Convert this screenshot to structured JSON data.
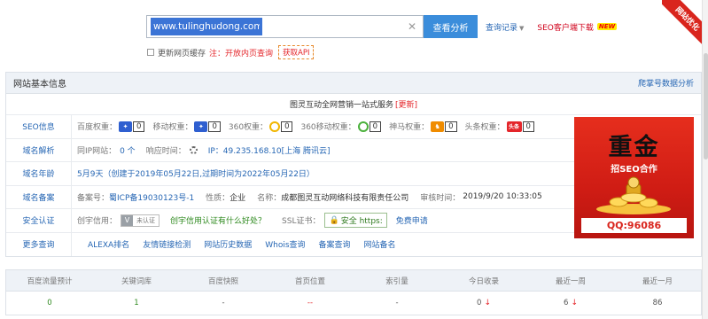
{
  "search": {
    "url_value": "www.tulinghudong.com/",
    "button_label": "查看分析",
    "history_label": "查询记录",
    "seo_download_label": "SEO客户端下载",
    "new_badge": "NEW"
  },
  "cache": {
    "label": "更新网页缓存",
    "note": "注：开放内页查询",
    "api_button": "获取API"
  },
  "ribbon_label": "网站优化",
  "panel": {
    "title": "网站基本信息",
    "right_link": "爬掌号数据分析",
    "company": "图灵互动全网营销一站式服务",
    "update": "[更新]"
  },
  "seo": {
    "label": "SEO信息",
    "items": [
      {
        "name": "百度权重：",
        "icon": "baidu-paw-icon",
        "value": "0"
      },
      {
        "name": "移动权重：",
        "icon": "baidu-paw-icon",
        "value": "0"
      },
      {
        "name": "360权重：",
        "icon": "360-icon",
        "value": "0"
      },
      {
        "name": "360移动权重：",
        "icon": "360-mobile-icon",
        "value": "0"
      },
      {
        "name": "神马权重：",
        "icon": "shenma-icon",
        "value": "0"
      },
      {
        "name": "头条权重：",
        "icon": "toutiao-icon",
        "value": "0"
      }
    ],
    "toutiao_icon_text": "头条"
  },
  "dns": {
    "label": "域名解析",
    "same_ip_label": "同IP网站：",
    "same_ip_value": "0 个",
    "response_label": "响应时间：",
    "ip_text": "IP：49.235.168.10[上海 腾讯云]"
  },
  "age": {
    "label": "域名年龄",
    "text": "5月9天（创建于2019年05月22日,过期时间为2022年05月22日）"
  },
  "icp": {
    "label": "域名备案",
    "no_label": "备案号：",
    "no_value": "蜀ICP备19030123号-1",
    "nature_label": "性质：",
    "nature_value": "企业",
    "name_label": "名称：",
    "name_value": "成都图灵互动网络科技有限责任公司",
    "audit_label": "审核时间：",
    "audit_value": "2019/9/20 10:33:05"
  },
  "security": {
    "label": "安全认证",
    "credit_label": "创宇信用：",
    "verify_text": "未认证",
    "credit_link": "创宇信用认证有什么好处？",
    "ssl_label": "SSL证书：",
    "https_text": "安全 https:",
    "apply_link": "免费申请"
  },
  "more": {
    "label": "更多查询",
    "links": [
      "ALEXA排名",
      "友情链接检测",
      "网站历史数据",
      "Whois查询",
      "备案查询",
      "网站备名"
    ]
  },
  "ad": {
    "headline": "重金",
    "sub": "招SEO合作",
    "qq": "QQ:96086"
  },
  "stats": {
    "headers": [
      "百度流量预计",
      "关键词库",
      "百度快照",
      "首页位置",
      "索引量",
      "今日收录",
      "最近一周",
      "最近一月"
    ],
    "values": [
      "0",
      "1",
      "-",
      "--",
      "-",
      "0",
      "6",
      "86"
    ]
  }
}
